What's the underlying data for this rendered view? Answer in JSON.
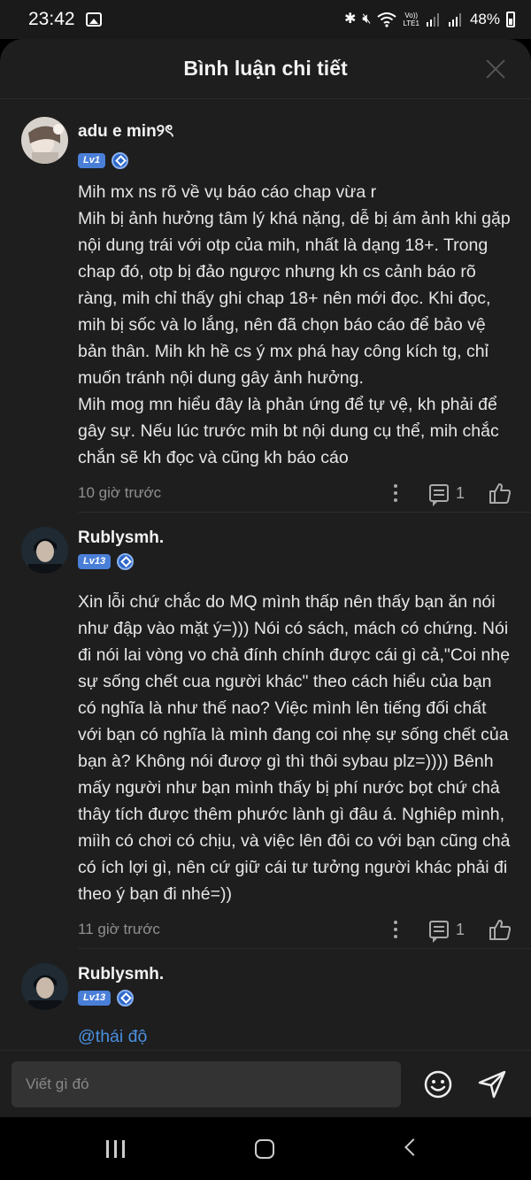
{
  "status_bar": {
    "time": "23:42",
    "battery": "48%",
    "icons": [
      "gallery-icon",
      "bluetooth-icon",
      "mute-icon",
      "wifi-icon",
      "volte-icon",
      "signal-icon",
      "battery-icon"
    ],
    "volte_label": "Vo))\nLTE1"
  },
  "sheet": {
    "title": "Bình luận chi tiết"
  },
  "comments": [
    {
      "username": "adu e min୨ৎ",
      "level": "Lv1",
      "text": "Mih mx ns rõ về vụ báo cáo chap vừa r\nMih bị ảnh hưởng tâm lý khá nặng, dễ bị ám ảnh khi gặp nội dung trái với otp của mih, nhất là dạng 18+. Trong chap đó, otp bị đảo ngược nhưng kh cs cảnh báo rõ ràng, mih chỉ thấy ghi chap 18+ nên mới đọc. Khi đọc, mih bị sốc và lo lắng, nên đã chọn báo cáo để bảo vệ bản thân. Mih kh hề cs ý mx phá hay công kích tg, chỉ muốn tránh nội dung gây ảnh hưởng.\nMih mog mn hiểu đây là phản ứng để tự vệ, kh phải để gây sự. Nếu lúc trước mih bt nội dung cụ thể, mih chắc chắn sẽ kh đọc và cũng kh báo cáo",
      "time": "10 giờ trước",
      "reply_count": "1"
    },
    {
      "username": "Rublysmh.",
      "level": "Lv13",
      "text": "Xin lỗi chứ chắc do MQ mình thấp nên thấy bạn ăn nói như đập vào mặt ý=))) Nói có sách, mách có chứng. Nói đi nói lai vòng vo chả đính chính được cái gì cả,\"Coi nhẹ sự sống chết cua người khác\" theo cách hiểu của bạn có nghĩa là như thế nao? Việc mình lên tiếng đối chất với bạn có nghĩa là mình đang coi nhẹ sự sống chết của bạn à? Không nói đươợ gì thì thôi sybau plz=)))) Bênh mấy người như bạn mình thấy bị phí nước bọt chứ chả thây tích được thêm phước lành gì đâu á. Nghiêp mình, miìh có chơi có chịu, và việc lên đôi co với bạn cũng chả có ích lợi gì, nên cứ giữ cái tư tưởng người khác phải đi theo ý bạn đi nhé=))",
      "time": "11 giờ trước",
      "reply_count": "1"
    },
    {
      "username": "Rublysmh.",
      "level": "Lv13",
      "text": "@thái độ",
      "time": "",
      "reply_count": ""
    }
  ],
  "input": {
    "placeholder": "Viết gì đó"
  },
  "colors": {
    "sheet_bg": "#1e1e1e",
    "badge_blue": "#4a7fd8",
    "mention_blue": "#4a8fe0",
    "text": "#e6e6e6",
    "muted": "#8f8f8f"
  }
}
